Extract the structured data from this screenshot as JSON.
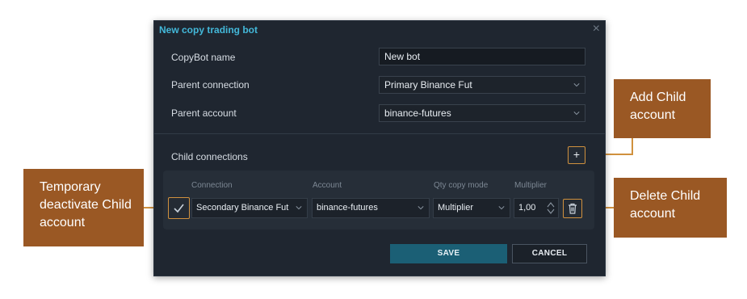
{
  "dialog": {
    "title": "New copy trading bot",
    "close_symbol": "×",
    "fields": [
      {
        "label": "CopyBot name",
        "value": "New bot"
      },
      {
        "label": "Parent connection",
        "value": "Primary Binance Fut"
      },
      {
        "label": "Parent account",
        "value": "binance-futures"
      }
    ],
    "child_connections_label": "Child connections",
    "add_symbol": "+",
    "columns": {
      "connection": "Connection",
      "account": "Account",
      "qty_mode": "Qty copy mode",
      "multiplier": "Multiplier"
    },
    "child_row": {
      "connection": "Secondary Binance Fut",
      "account": "binance-futures",
      "qty_mode": "Multiplier",
      "multiplier": "1,00"
    },
    "save_label": "SAVE",
    "cancel_label": "CANCEL"
  },
  "callouts": {
    "add_child": "Add Child account",
    "temp_deactivate": "Temporary deactivate Child account",
    "delete_child": "Delete Child account"
  },
  "colors": {
    "accent_title": "#43b8d9",
    "callout_bg": "#9a5824",
    "highlight_border": "#d0913e",
    "save_button": "#1b5f75"
  },
  "icons": [
    "close-icon",
    "chevron-down-icon",
    "plus-icon",
    "checkmark-icon",
    "spinner-arrows-icon",
    "trash-icon"
  ]
}
